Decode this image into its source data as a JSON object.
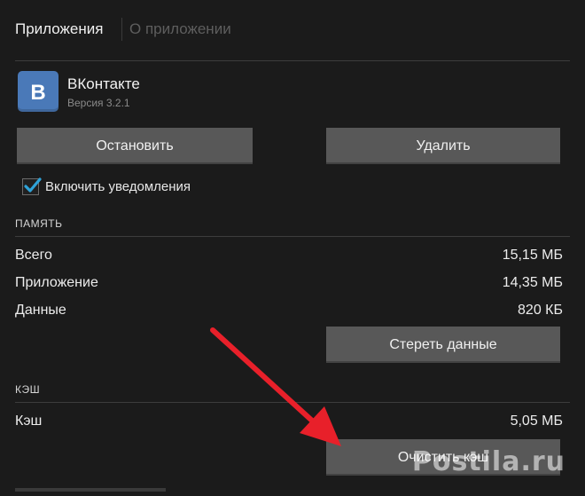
{
  "header": {
    "tab_app": "Приложения",
    "tab_about": "О приложении"
  },
  "app": {
    "name": "ВКонтакте",
    "version": "Версия 3.2.1",
    "icon": "vk-logo-icon",
    "icon_color": "#4a79b8"
  },
  "actions": {
    "stop_label": "Остановить",
    "delete_label": "Удалить"
  },
  "notifications": {
    "label": "Включить уведомления",
    "checked": true,
    "accent": "#2fa3d9"
  },
  "memory": {
    "heading": "ПАМЯТЬ",
    "rows": [
      {
        "label": "Всего",
        "value": "15,15 МБ"
      },
      {
        "label": "Приложение",
        "value": "14,35 МБ"
      },
      {
        "label": "Данные",
        "value": "820 КБ"
      }
    ],
    "clear_label": "Стереть данные"
  },
  "cache": {
    "heading": "КЭШ",
    "rows": [
      {
        "label": "Кэш",
        "value": "5,05 МБ"
      }
    ],
    "clear_label": "Очистить кэш"
  },
  "overlay": {
    "arrow_color": "#e8202a",
    "watermark": "Postila.ru"
  }
}
